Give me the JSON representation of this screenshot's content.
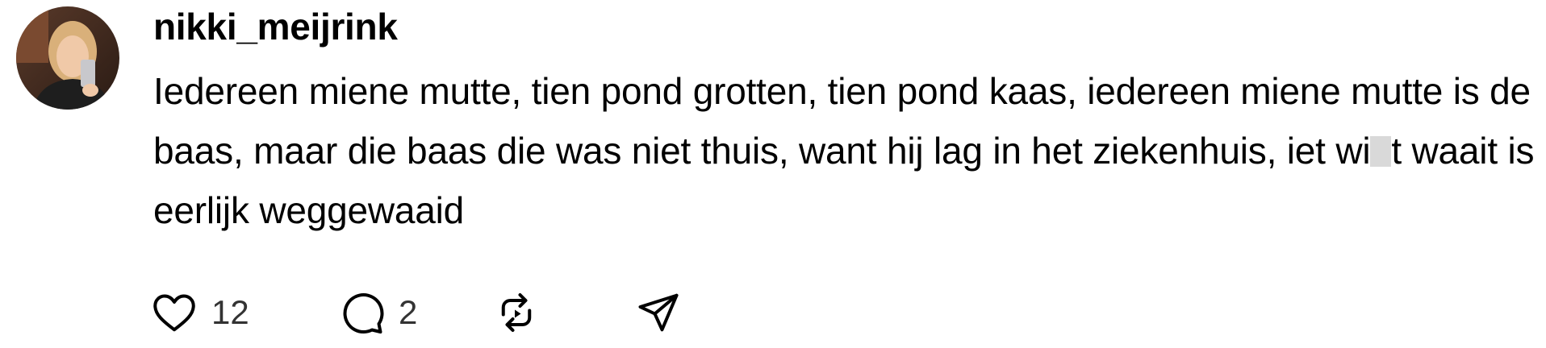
{
  "post": {
    "username": "nikki_meijrink",
    "text_before_redaction": "Iedereen miene mutte, tien pond grotten, tien pond kaas, iedereen miene mutte is de baas, maar die baas die was niet thuis, want hij lag in het ziekenhuis, iet wi",
    "text_after_redaction": "t waait is eerlijk weggewaaid"
  },
  "actions": {
    "like": {
      "icon": "heart-icon",
      "count": "12"
    },
    "reply": {
      "icon": "speech-bubble-icon",
      "count": "2"
    },
    "repost": {
      "icon": "repost-arrows-icon"
    },
    "share": {
      "icon": "send-paper-plane-icon"
    }
  },
  "colors": {
    "text": "#000000",
    "count_text": "#333333",
    "redaction": "#d9d9d9",
    "background": "#ffffff"
  }
}
